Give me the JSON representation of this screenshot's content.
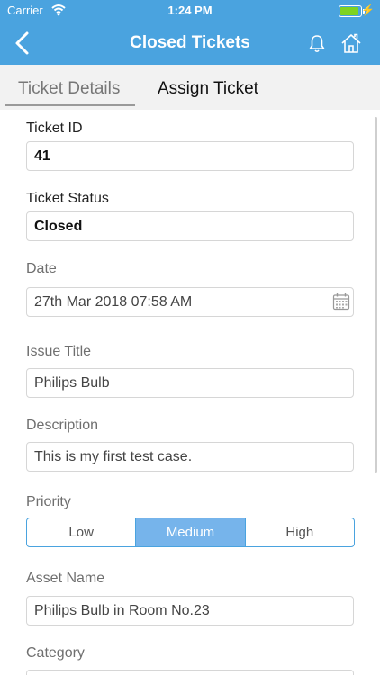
{
  "status_bar": {
    "carrier": "Carrier",
    "time": "1:24 PM"
  },
  "nav": {
    "title": "Closed Tickets"
  },
  "tabs": [
    "Ticket Details",
    "Assign Ticket"
  ],
  "form": {
    "ticket_id": {
      "label": "Ticket ID",
      "value": "41"
    },
    "ticket_status": {
      "label": "Ticket Status",
      "value": "Closed"
    },
    "date": {
      "label": "Date",
      "value": "27th Mar 2018 07:58 AM"
    },
    "issue_title": {
      "label": "Issue Title",
      "value": "Philips Bulb"
    },
    "description": {
      "label": "Description",
      "value": "This is my first test case."
    },
    "priority": {
      "label": "Priority",
      "options": [
        "Low",
        "Medium",
        "High"
      ],
      "selected": "Medium"
    },
    "asset_name": {
      "label": "Asset Name",
      "value": "Philips Bulb in Room No.23"
    },
    "category": {
      "label": "Category"
    }
  },
  "colors": {
    "accent": "#4aa3df",
    "selected_segment": "#76b4eb"
  },
  "icons": [
    "wifi-icon",
    "battery-icon",
    "back-chevron-icon",
    "bell-icon",
    "home-icon",
    "calendar-icon"
  ]
}
